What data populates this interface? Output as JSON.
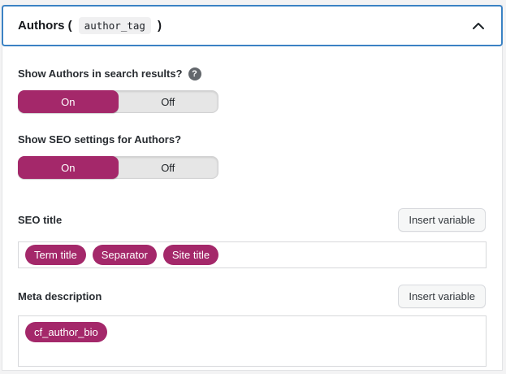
{
  "panel": {
    "title_prefix": "Authors (",
    "title_code": "author_tag",
    "title_suffix": ")"
  },
  "icons": {
    "collapse": "chevron-up",
    "help": "?"
  },
  "colors": {
    "accent_magenta": "#a4286a",
    "focus_border_blue": "#3b82c4",
    "toggle_track": "#e6e6e6",
    "panel_background": "#ffffff"
  },
  "toggles": [
    {
      "label": "Show Authors in search results?",
      "has_help": true,
      "on_label": "On",
      "off_label": "Off",
      "value": "On"
    },
    {
      "label": "Show SEO settings for Authors?",
      "has_help": false,
      "on_label": "On",
      "off_label": "Off",
      "value": "On"
    }
  ],
  "fields": [
    {
      "label": "SEO title",
      "button": "Insert variable",
      "tags": [
        "Term title",
        "Separator",
        "Site title"
      ]
    },
    {
      "label": "Meta description",
      "button": "Insert variable",
      "tags": [
        "cf_author_bio"
      ]
    }
  ]
}
